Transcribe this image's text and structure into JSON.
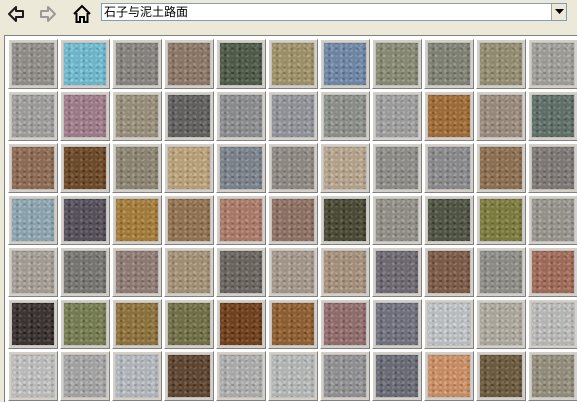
{
  "toolbar": {
    "back_icon": "back-arrow-icon",
    "forward_icon": "forward-arrow-icon",
    "home_icon": "home-icon",
    "back_color": "#1c1c1c",
    "forward_color": "#9a9a9a"
  },
  "category": {
    "selected": "石子与泥土路面",
    "dropdown_icon": "chevron-down-icon"
  },
  "textures": [
    [
      "#8e8a86",
      "#6fb3c6",
      "#84807c",
      "#8a7666",
      "#4f5a48",
      "#9a8e68",
      "#6f84a0",
      "#868772",
      "#7d8072",
      "#8f8a70",
      "#9c9a94"
    ],
    [
      "#9c9a98",
      "#9a7a86",
      "#948c78",
      "#62605e",
      "#888a8c",
      "#8e9096",
      "#8a8c88",
      "#9a9a9a",
      "#9c6b3a",
      "#96887a",
      "#5f6e66"
    ],
    [
      "#8a6a54",
      "#6a4a2a",
      "#8a8270",
      "#b49e7a",
      "#7a8088",
      "#8c8680",
      "#b0a08a",
      "#8c8a86",
      "#88888a",
      "#8a6e52",
      "#7c7674"
    ],
    [
      "#8aa0aa",
      "#56505a",
      "#a07a3c",
      "#8e7052",
      "#a67868",
      "#8a7062",
      "#4a4a36",
      "#8e8c84",
      "#505444",
      "#7a7a40",
      "#94908a"
    ],
    [
      "#a09a92",
      "#767470",
      "#8c7a72",
      "#a08e74",
      "#6a645e",
      "#a09488",
      "#a08e7a",
      "#6e6870",
      "#7a5a48",
      "#8c8a84",
      "#9c6a58"
    ],
    [
      "#3c3432",
      "#747a52",
      "#8a703e",
      "#706e48",
      "#6e4220",
      "#8c5e34",
      "#8e6c6c",
      "#70707c",
      "#b8bcbe",
      "#a8a49a",
      "#b4b4b2"
    ],
    [
      "#b8b8b8",
      "#a0a0a0",
      "#aeb2b6",
      "#5e4634",
      "#a8a8a8",
      "#b0b2b2",
      "#8e8e90",
      "#6a6a74",
      "#c48c64",
      "#6a5a40",
      "#908a7a"
    ]
  ]
}
